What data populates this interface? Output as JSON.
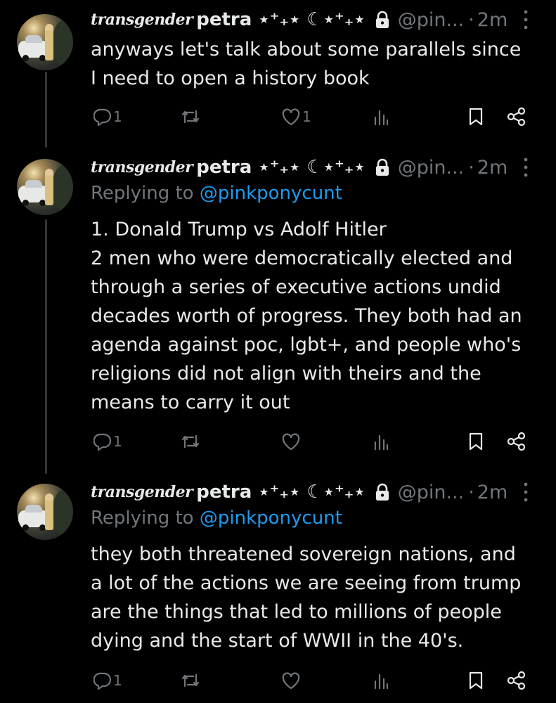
{
  "colors": {
    "background": "#000000",
    "text_primary": "#e7e9ea",
    "text_secondary": "#71767b",
    "link": "#1d9bf0",
    "thread_line": "#333639"
  },
  "tweets": [
    {
      "author_fancy": "transgender",
      "author_name": "petra ⋆⁺₊⋆ ☾⋆⁺₊⋆",
      "handle": "@pin...",
      "separator": "·",
      "time": "2m",
      "replying_to_prefix": "",
      "replying_to_handle": "",
      "body_lines": [
        "anyways let's talk about some parallels since",
        "I need to open a history book"
      ],
      "reply_count": "1",
      "like_count": "1"
    },
    {
      "author_fancy": "transgender",
      "author_name": "petra ⋆⁺₊⋆ ☾⋆⁺₊⋆",
      "handle": "@pin...",
      "separator": "·",
      "time": "2m",
      "replying_to_prefix": "Replying to ",
      "replying_to_handle": "@pinkponycunt",
      "body_lines": [
        "1. Donald Trump vs Adolf Hitler",
        "2 men who were democratically elected and",
        "through a series of executive actions undid",
        "decades worth of progress. They both had an",
        "agenda against poc, lgbt+, and people who's",
        "religions did not align with theirs and the",
        "means to carry it out"
      ],
      "reply_count": "1",
      "like_count": ""
    },
    {
      "author_fancy": "transgender",
      "author_name": "petra ⋆⁺₊⋆ ☾⋆⁺₊⋆",
      "handle": "@pin...",
      "separator": "·",
      "time": "2m",
      "replying_to_prefix": "Replying to ",
      "replying_to_handle": "@pinkponycunt",
      "body_lines": [
        "they both threatened sovereign nations, and",
        "a lot of the actions we are seeing from trump",
        "are the things that led to millions of people",
        "dying and the start of WWII in the 40's."
      ],
      "reply_count": "1",
      "like_count": ""
    }
  ]
}
